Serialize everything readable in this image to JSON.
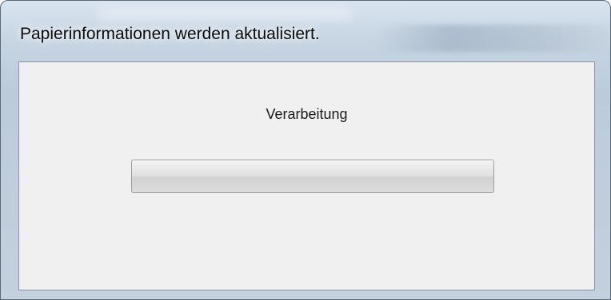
{
  "window": {
    "title": "Papierinformationen werden aktualisiert."
  },
  "dialog": {
    "status_text": "Verarbeitung",
    "progress": 0
  }
}
